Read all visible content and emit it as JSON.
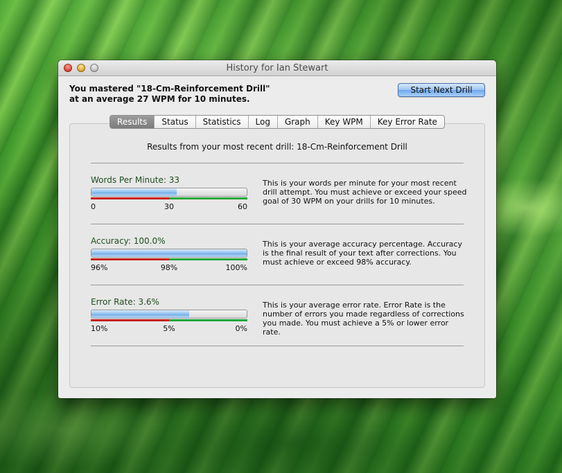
{
  "window": {
    "title": "History for Ian Stewart"
  },
  "summary": {
    "line1": "You mastered \"18-Cm-Reinforcement Drill\"",
    "line2": "at an average 27 WPM for 10 minutes."
  },
  "actions": {
    "start_next_drill": "Start Next Drill"
  },
  "tabs": [
    {
      "label": "Results",
      "active": true
    },
    {
      "label": "Status"
    },
    {
      "label": "Statistics"
    },
    {
      "label": "Log"
    },
    {
      "label": "Graph"
    },
    {
      "label": "Key WPM"
    },
    {
      "label": "Key Error Rate"
    }
  ],
  "results": {
    "heading": "Results from your most recent drill: 18-Cm-Reinforcement Drill",
    "metrics": [
      {
        "label": "Words Per Minute: 33",
        "fill_fraction": 0.55,
        "red_fraction": 0.5,
        "ticks": [
          "0",
          "30",
          "60"
        ],
        "description": "This is your words per minute for your most recent drill attempt. You must achieve or exceed your speed goal of 30 WPM on your drills for 10 minutes."
      },
      {
        "label": "Accuracy: 100.0%",
        "fill_fraction": 1.0,
        "red_fraction": 0.5,
        "ticks": [
          "96%",
          "98%",
          "100%"
        ],
        "description": "This is your average accuracy percentage. Accuracy is the final result of your text after corrections. You must achieve or exceed 98% accuracy."
      },
      {
        "label": "Error Rate: 3.6%",
        "fill_fraction": 0.63,
        "red_fraction": 0.5,
        "ticks": [
          "10%",
          "5%",
          "0%"
        ],
        "description": "This is your average error rate. Error Rate is the number of errors you made regardless of corrections you made. You must achieve a 5% or lower error rate."
      }
    ]
  },
  "colors": {
    "threshold_fail": "#c81a1a",
    "threshold_pass": "#18a83a",
    "accent": "#6ea6ea"
  }
}
